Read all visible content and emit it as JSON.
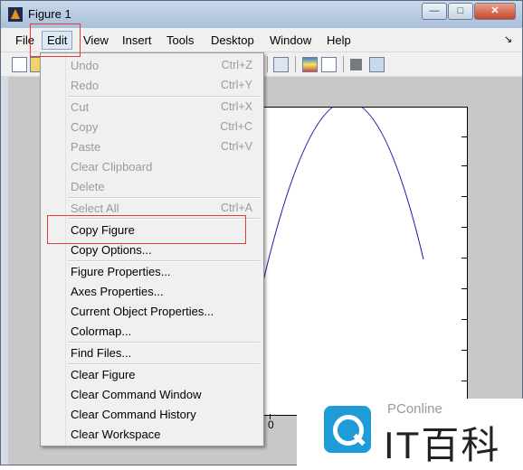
{
  "window": {
    "title": "Figure 1"
  },
  "menubar": {
    "items": [
      "File",
      "Edit",
      "View",
      "Insert",
      "Tools",
      "Desktop",
      "Window",
      "Help"
    ],
    "active": "Edit"
  },
  "edit_menu": {
    "undo": {
      "label": "Undo",
      "shortcut": "Ctrl+Z"
    },
    "redo": {
      "label": "Redo",
      "shortcut": "Ctrl+Y"
    },
    "cut": {
      "label": "Cut",
      "shortcut": "Ctrl+X"
    },
    "copy": {
      "label": "Copy",
      "shortcut": "Ctrl+C"
    },
    "paste": {
      "label": "Paste",
      "shortcut": "Ctrl+V"
    },
    "clear_clipboard": {
      "label": "Clear Clipboard"
    },
    "delete": {
      "label": "Delete"
    },
    "select_all": {
      "label": "Select All",
      "shortcut": "Ctrl+A"
    },
    "copy_figure": {
      "label": "Copy Figure"
    },
    "copy_options": {
      "label": "Copy Options..."
    },
    "figure_properties": {
      "label": "Figure Properties..."
    },
    "axes_properties": {
      "label": "Axes Properties..."
    },
    "current_object_properties": {
      "label": "Current Object Properties..."
    },
    "colormap": {
      "label": "Colormap..."
    },
    "find_files": {
      "label": "Find Files..."
    },
    "clear_figure": {
      "label": "Clear Figure"
    },
    "clear_command_window": {
      "label": "Clear Command Window"
    },
    "clear_command_history": {
      "label": "Clear Command History"
    },
    "clear_workspace": {
      "label": "Clear Workspace"
    }
  },
  "plot": {
    "x_tick_label": "0",
    "line_color": "#1a1aa8"
  },
  "watermark": {
    "small_text": "PConline",
    "big_text": "IT百科"
  },
  "colors": {
    "highlight": "#e33b3b",
    "logo_blue": "#1f9bd8"
  }
}
